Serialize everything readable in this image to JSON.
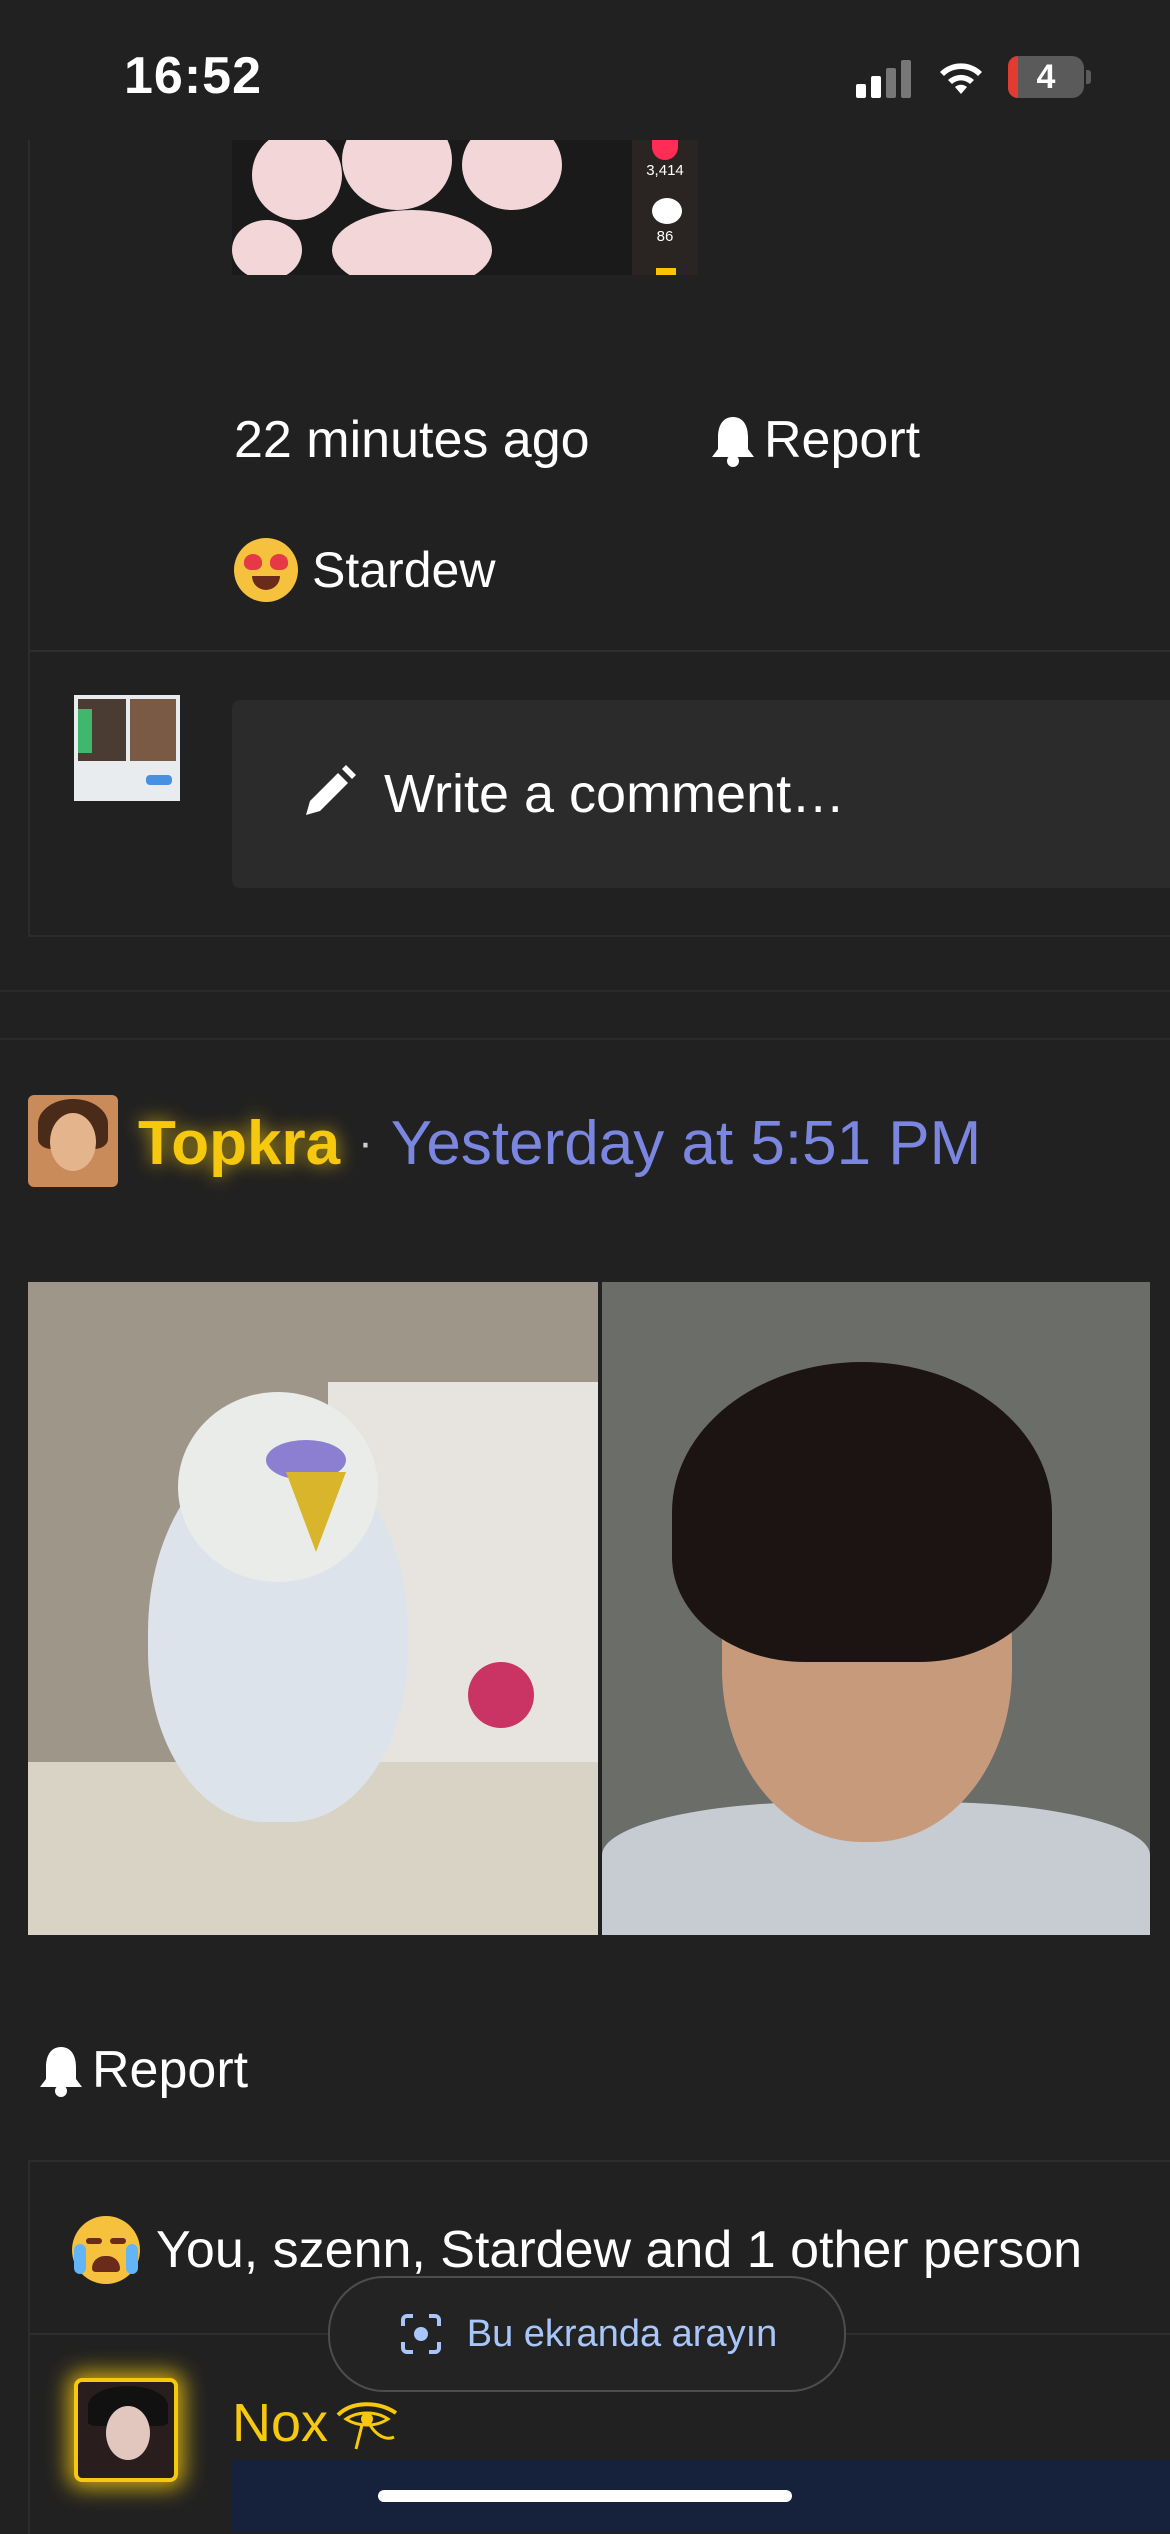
{
  "status_bar": {
    "time": "16:52",
    "battery": "4"
  },
  "post_top": {
    "video": {
      "likes": "3,414",
      "comments": "86"
    },
    "timestamp": "22 minutes ago",
    "report_label": "Report",
    "reaction": {
      "emoji": "heart-eyes",
      "names": "Stardew"
    },
    "comment_placeholder": "Write a comment…"
  },
  "post_main": {
    "author": "Topkra",
    "separator": "·",
    "timestamp": "Yesterday at 5:51 PM",
    "report_label": "Report",
    "reactions_text": "You, szenn, Stardew and 1 other person",
    "reaction_emoji": "crying-laughing"
  },
  "comment": {
    "author": "Nox"
  },
  "overlay": {
    "search_screen_label": "Bu ekranda arayın"
  },
  "colors": {
    "accent_gold": "#f6c90e",
    "timestamp_blue": "#7a86e0",
    "background": "#212121"
  }
}
